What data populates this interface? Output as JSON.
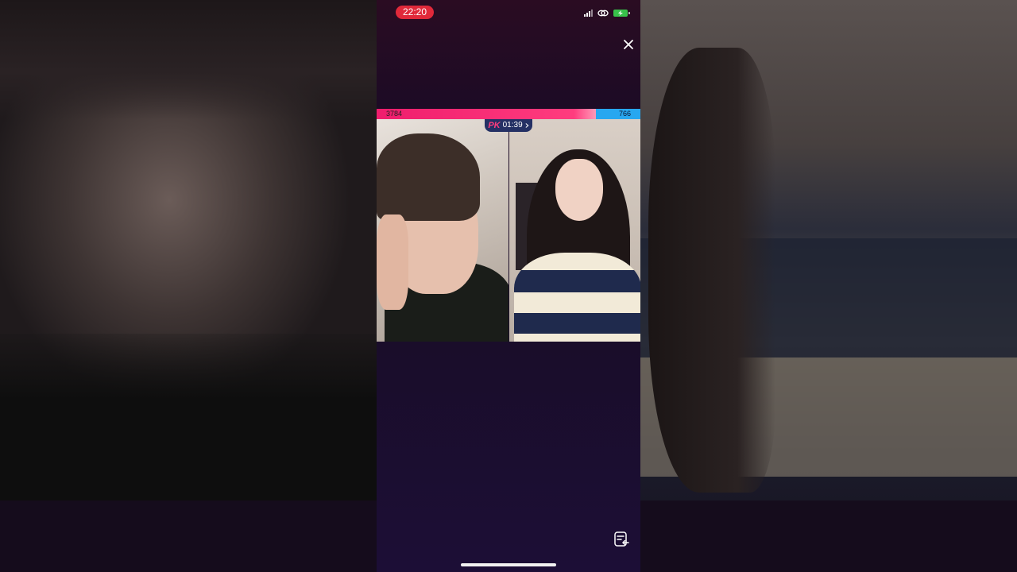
{
  "status_bar": {
    "time": "22:20",
    "time_pill_color": "#e0293a",
    "icons": [
      "signal-icon",
      "link-icon",
      "battery-charging-icon"
    ]
  },
  "pk": {
    "left_score": "3784",
    "right_score": "766",
    "badge": "PK",
    "timer": "01:39",
    "colors": {
      "left": "#ef1d6d",
      "right": "#27a7f0"
    },
    "left_share": 0.83
  },
  "controls": {
    "close_icon": "close-icon",
    "subtitle_icon": "subtitle-toggle-icon"
  }
}
